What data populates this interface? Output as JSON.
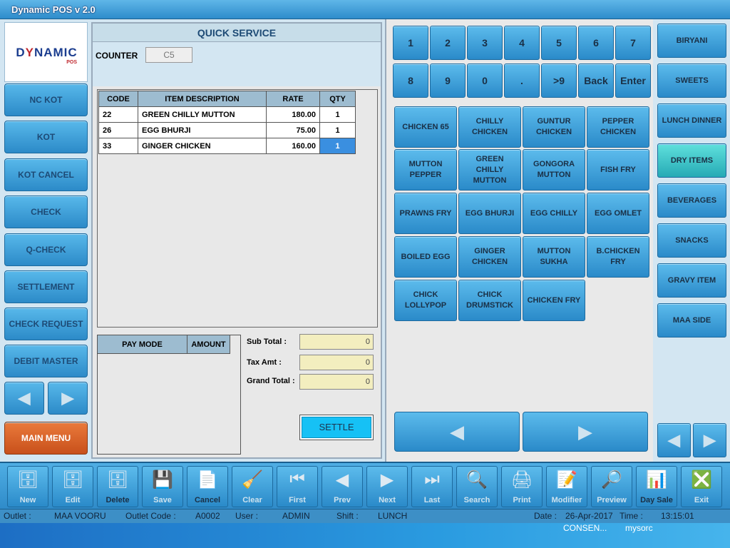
{
  "window": {
    "title": "Dynamic POS v 2.0"
  },
  "logo": {
    "text_a": "D",
    "text_b": "NAMIC",
    "sub": "POS",
    "mark": "Y"
  },
  "left_menu": [
    {
      "label": "NC KOT"
    },
    {
      "label": "KOT"
    },
    {
      "label": "KOT CANCEL"
    },
    {
      "label": "CHECK"
    },
    {
      "label": "Q-CHECK"
    },
    {
      "label": "SETTLEMENT"
    },
    {
      "label": "CHECK REQUEST"
    },
    {
      "label": "DEBIT MASTER"
    }
  ],
  "left_arrows": {
    "prev": "◀",
    "next": "▶"
  },
  "main_menu": {
    "label": "MAIN MENU"
  },
  "quick_service": {
    "title": "QUICK SERVICE",
    "counter_label": "COUNTER",
    "counter_value": "C5",
    "columns": [
      "CODE",
      "ITEM DESCRIPTION",
      "RATE",
      "QTY"
    ],
    "rows": [
      {
        "code": "22",
        "desc": "GREEN CHILLY MUTTON",
        "rate": "180.00",
        "qty": "1"
      },
      {
        "code": "26",
        "desc": "EGG BHURJI",
        "rate": "75.00",
        "qty": "1"
      },
      {
        "code": "33",
        "desc": "GINGER CHICKEN",
        "rate": "160.00",
        "qty": "1"
      }
    ],
    "pay_columns": [
      "PAY MODE",
      "AMOUNT"
    ],
    "sub_total_label": "Sub Total :",
    "sub_total": "0",
    "tax_label": "Tax Amt :",
    "tax": "0",
    "grand_label": "Grand Total :",
    "grand": "0",
    "settle_label": "SETTLE"
  },
  "numpad": [
    "1",
    "2",
    "3",
    "4",
    "5",
    "6",
    "7",
    "8",
    "9",
    "0",
    ".",
    ">9",
    "Back",
    "Enter"
  ],
  "items": [
    "CHICKEN 65",
    "CHILLY CHICKEN",
    "GUNTUR CHICKEN",
    "PEPPER CHICKEN",
    "MUTTON PEPPER",
    "GREEN CHILLY MUTTON",
    "GONGORA MUTTON",
    "FISH FRY",
    "PRAWNS FRY",
    "EGG BHURJI",
    "EGG CHILLY",
    "EGG OMLET",
    "BOILED EGG",
    "GINGER CHICKEN",
    "MUTTON SUKHA",
    "B.CHICKEN FRY",
    "CHICK LOLLYPOP",
    "CHICK DRUMSTICK",
    "CHICKEN FRY"
  ],
  "item_pager": {
    "prev": "◀",
    "next": "▶"
  },
  "categories": [
    {
      "label": "BIRYANI"
    },
    {
      "label": "SWEETS"
    },
    {
      "label": "LUNCH DINNER"
    },
    {
      "label": "DRY ITEMS",
      "selected": true
    },
    {
      "label": "BEVERAGES"
    },
    {
      "label": "SNACKS"
    },
    {
      "label": "GRAVY ITEM"
    },
    {
      "label": "MAA SIDE"
    }
  ],
  "category_pager": {
    "prev": "◀",
    "next": "▶"
  },
  "toolbar": [
    {
      "label": "New",
      "icon": "🗄"
    },
    {
      "label": "Edit",
      "icon": "🗄"
    },
    {
      "label": "Delete",
      "icon": "🗄",
      "active": true
    },
    {
      "label": "Save",
      "icon": "💾"
    },
    {
      "label": "Cancel",
      "icon": "📄",
      "active": true
    },
    {
      "label": "Clear",
      "icon": "🧹"
    },
    {
      "label": "First",
      "icon": "⏮"
    },
    {
      "label": "Prev",
      "icon": "◀"
    },
    {
      "label": "Next",
      "icon": "▶"
    },
    {
      "label": "Last",
      "icon": "⏭"
    },
    {
      "label": "Search",
      "icon": "🔍"
    },
    {
      "label": "Print",
      "icon": "🖨"
    },
    {
      "label": "Modifier",
      "icon": "📝"
    },
    {
      "label": "Preview",
      "icon": "🔎"
    },
    {
      "label": "Day Sale",
      "icon": "📊",
      "active": true
    },
    {
      "label": "Exit",
      "icon": "❎"
    }
  ],
  "status": {
    "outlet_label": "Outlet :",
    "outlet": "MAA VOORU",
    "code_label": "Outlet Code :",
    "code": "A0002",
    "user_label": "User :",
    "user": "ADMIN",
    "shift_label": "Shift :",
    "shift": "LUNCH",
    "date_label": "Date :",
    "date": "26-Apr-2017",
    "time_label": "Time :",
    "time": "13:15:01"
  },
  "desktop": {
    "item1": "CONSEN...",
    "item2": "mysorc"
  }
}
